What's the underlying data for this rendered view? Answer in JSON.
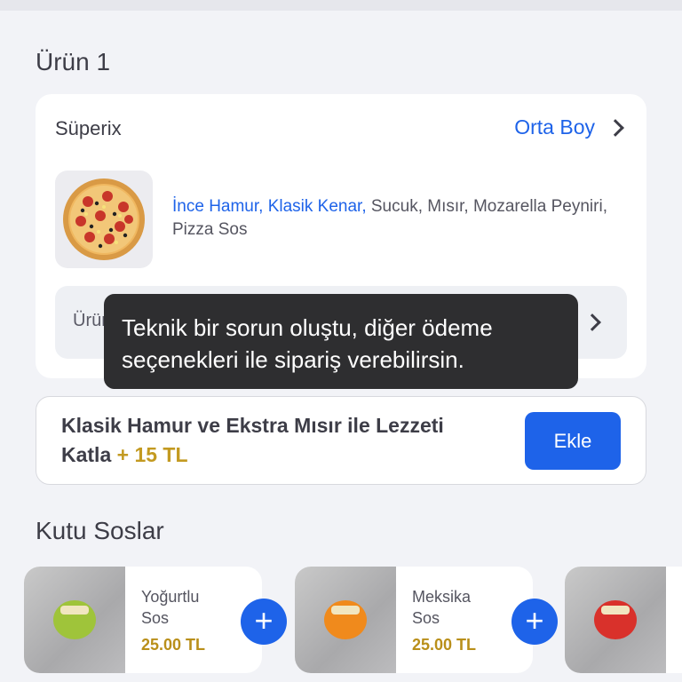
{
  "section1": {
    "title": "Ürün 1"
  },
  "product": {
    "name": "Süperix",
    "size_label": "Orta Boy",
    "desc_highlight": "İnce Hamur, Klasik Kenar,",
    "desc_rest": " Sucuk, Mısır, Mozarella Peyniri, Pizza Sos",
    "note_placeholder": "Ürün notu ekleyin"
  },
  "toast": {
    "message": "Teknik bir sorun oluştu, diğer ödeme seçenekleri ile sipariş verebilirsin."
  },
  "promo": {
    "text": "Klasik Hamur ve Ekstra Mısır ile Lezzeti Katla",
    "price": "+ 15 TL",
    "button_label": "Ekle"
  },
  "section2": {
    "title": "Kutu Soslar"
  },
  "sauces": [
    {
      "name": "Yoğurtlu Sos",
      "price": "25.00 TL",
      "color": "#9fc43a"
    },
    {
      "name": "Meksika Sos",
      "price": "25.00 TL",
      "color": "#f08a1c"
    },
    {
      "name": "",
      "price": "",
      "color": "#d9312b"
    }
  ],
  "colors": {
    "accent": "#1e63e9",
    "price": "#c39a21",
    "toast_bg": "#2e2e30"
  }
}
